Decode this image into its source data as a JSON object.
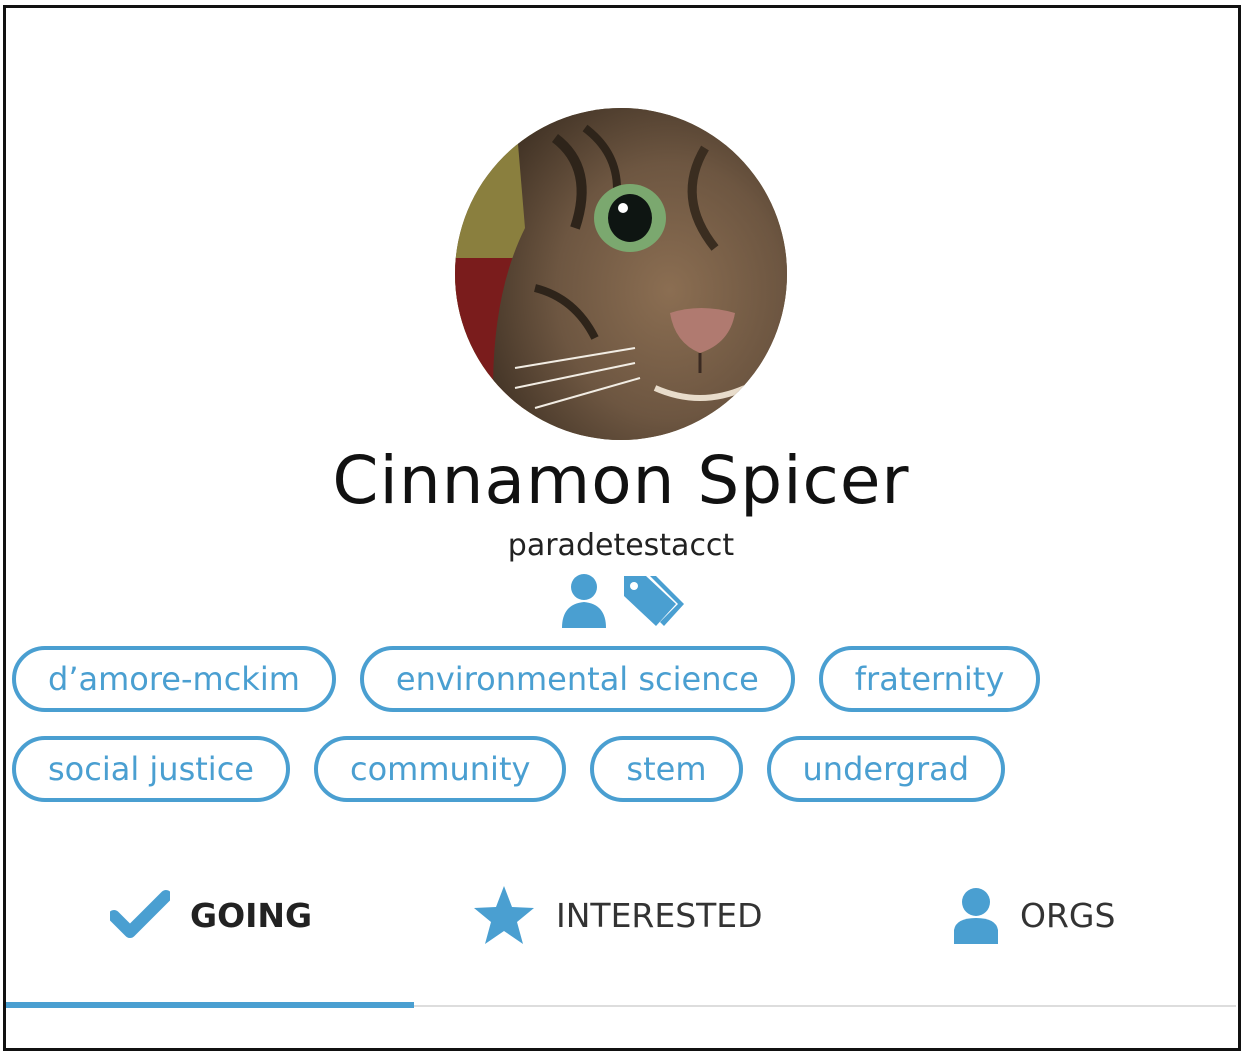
{
  "profile": {
    "name": "Cinnamon Spicer",
    "username": "paradetestacct",
    "avatar_icon": "cat-photo"
  },
  "header_icons": [
    "user-icon",
    "tags-icon"
  ],
  "tags": {
    "row1": [
      "d’amore-mckim",
      "environmental science",
      "fraternity"
    ],
    "row2": [
      "social justice",
      "community",
      "stem",
      "undergrad"
    ]
  },
  "tabs": {
    "going": "GOING",
    "interested": "INTERESTED",
    "orgs": "ORGS",
    "active": "going"
  },
  "colors": {
    "accent": "#4a9fd1",
    "text": "#111111"
  }
}
